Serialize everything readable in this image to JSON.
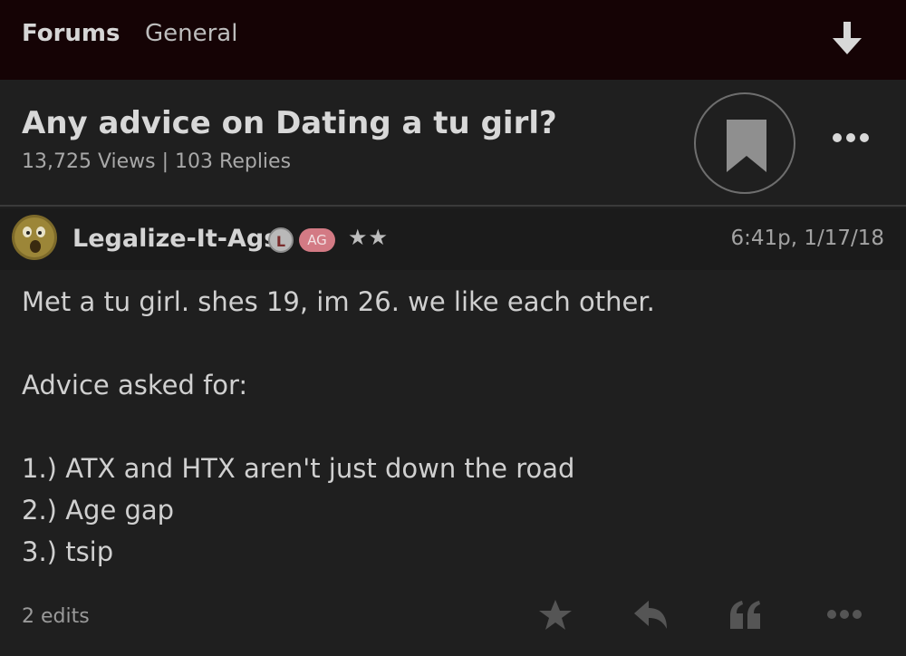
{
  "topbar": {
    "breadcrumb": [
      "Forums",
      "General"
    ],
    "download_icon": "arrow-down-icon"
  },
  "thread": {
    "title": "Any advice on Dating a tu girl?",
    "stats": "13,725 Views | 103 Replies",
    "bookmark_icon": "bookmark-icon",
    "more_icon": "more-horizontal-icon"
  },
  "post": {
    "author": "Legalize-It-Ags",
    "badge_l": "L",
    "badge_ag": "AG",
    "stars": "★★",
    "timestamp": "6:41p, 1/17/18",
    "lines": [
      "Met a tu girl. shes 19, im 26. we like each other.",
      "Advice asked for:",
      "1.) ATX and HTX aren't just down the road",
      "2.) Age gap",
      "3.) tsip"
    ],
    "edits": "2 edits",
    "actions": [
      "star-icon",
      "reply-icon",
      "quote-icon",
      "more-icon"
    ]
  },
  "colors": {
    "topbar_bg": "#150305",
    "page_bg": "#1f1f1f",
    "badge_ag": "#d37a84"
  }
}
